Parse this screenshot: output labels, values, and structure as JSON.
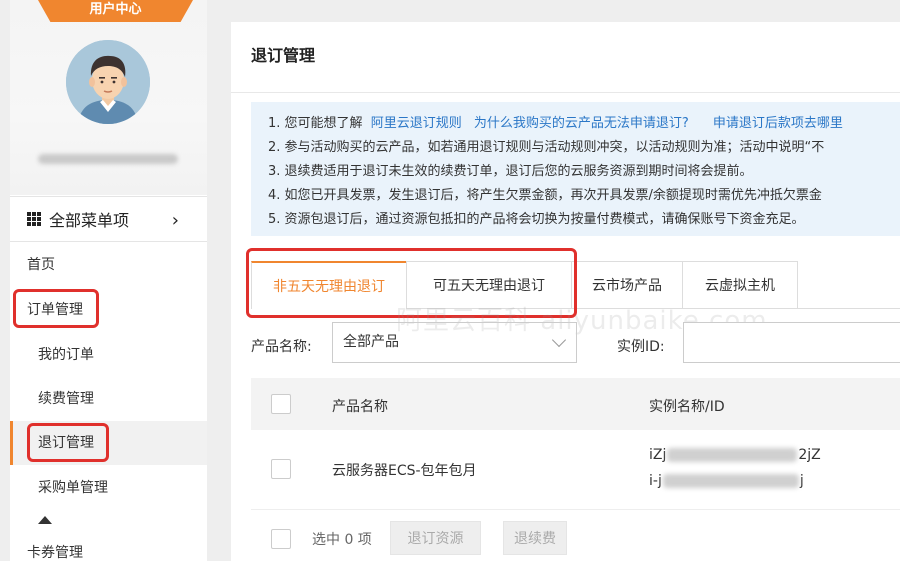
{
  "sidebar": {
    "header_tag": "用户中心",
    "all_menu_label": "全部菜单项",
    "items": [
      {
        "label": "首页"
      },
      {
        "label": "订单管理"
      },
      {
        "label": "我的订单"
      },
      {
        "label": "续费管理"
      },
      {
        "label": "退订管理"
      },
      {
        "label": "采购单管理"
      },
      {
        "label": "卡券管理"
      }
    ],
    "accent_color": "#f0862f",
    "highlight_color": "#e0302c"
  },
  "main": {
    "title": "退订管理",
    "notice": {
      "line1_prefix": "1. 您可能想了解",
      "link1": "阿里云退订规则",
      "link2": "为什么我购买的云产品无法申请退订?",
      "link3": "申请退订后款项去哪里",
      "line2": "2. 参与活动购买的云产品，如若通用退订规则与活动规则冲突，以活动规则为准；活动中说明“不",
      "line3": "3. 退续费适用于退订未生效的续费订单，退订后您的云服务资源到期时间将会提前。",
      "line4": "4. 如您已开具发票，发生退订后，将产生欠票金额，再次开具发票/余额提现时需优先冲抵欠票金",
      "line5": "5. 资源包退订后，通过资源包抵扣的产品将会切换为按量付费模式，请确保账号下资金充足。"
    },
    "tabs": [
      {
        "label": "非五天无理由退订"
      },
      {
        "label": "可五天无理由退订"
      },
      {
        "label": "云市场产品"
      },
      {
        "label": "云虚拟主机"
      }
    ],
    "watermark": "阿里云百科 aliyunbaike.com",
    "filter": {
      "product_label": "产品名称:",
      "product_value": "全部产品",
      "instance_label": "实例ID:"
    },
    "table": {
      "headers": [
        "产品名称",
        "实例名称/ID"
      ],
      "rows": [
        {
          "product": "云服务器ECS-包年包月",
          "id_line1_start": "iZj",
          "id_line1_end": "2jZ",
          "id_line2_start": "i-j",
          "id_line2_end": "j"
        }
      ]
    },
    "footer": {
      "selected_text": "选中 0 项",
      "unsubscribe_button": "退订资源",
      "refund_renew_button": "退续费"
    }
  }
}
